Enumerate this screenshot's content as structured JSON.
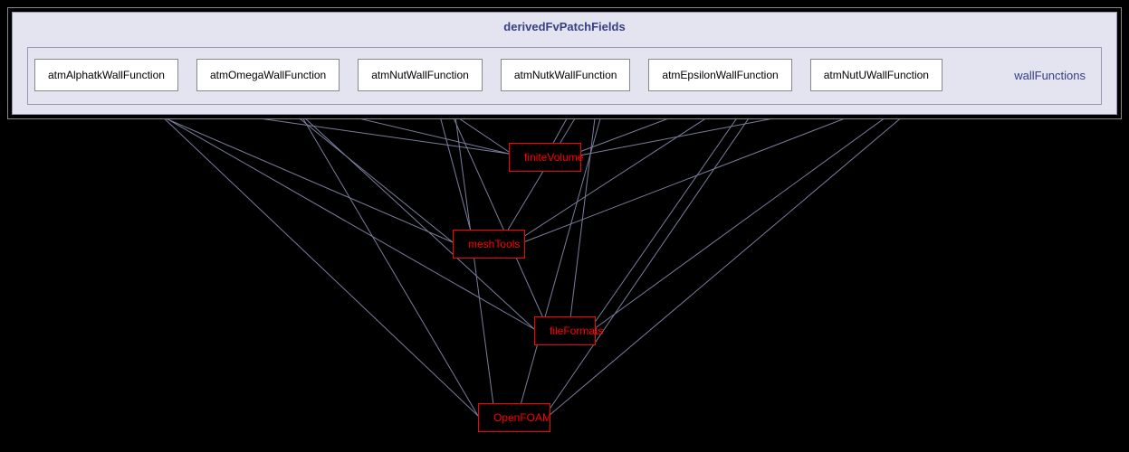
{
  "header": {
    "title": "derivedFvPatchFields"
  },
  "right_label": "wallFunctions",
  "wall_functions": [
    {
      "label": "atmAlphatkWallFunction"
    },
    {
      "label": "atmOmegaWallFunction"
    },
    {
      "label": "atmNutWallFunction"
    },
    {
      "label": "atmNutkWallFunction"
    },
    {
      "label": "atmEpsilonWallFunction"
    },
    {
      "label": "atmNutUWallFunction"
    }
  ],
  "dependency_chain": [
    {
      "label": "finiteVolume"
    },
    {
      "label": "meshTools"
    },
    {
      "label": "fileFormats"
    },
    {
      "label": "OpenFOAM"
    }
  ],
  "chart_data": {
    "type": "diagram",
    "description": "Directory/module dependency graph",
    "parent": "derivedFvPatchFields",
    "group": "wallFunctions",
    "modules": [
      "atmAlphatkWallFunction",
      "atmOmegaWallFunction",
      "atmNutWallFunction",
      "atmNutkWallFunction",
      "atmEpsilonWallFunction",
      "atmNutUWallFunction"
    ],
    "depends_on_chain": [
      "finiteVolume",
      "meshTools",
      "fileFormats",
      "OpenFOAM"
    ],
    "edges_from_modules_to": [
      "finiteVolume",
      "meshTools",
      "fileFormats",
      "OpenFOAM"
    ]
  }
}
